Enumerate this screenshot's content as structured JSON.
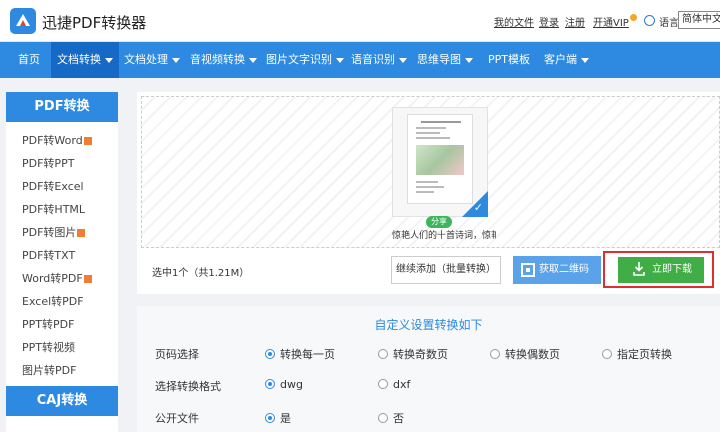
{
  "header": {
    "brand": "迅捷PDF转换器",
    "links": {
      "my_files": "我的文件",
      "login": "登录",
      "register": "注册",
      "vip": "开通VIP",
      "language": "语言",
      "language_current": "简体中文"
    }
  },
  "nav": {
    "items": [
      {
        "label": "首页"
      },
      {
        "label": "文档转换"
      },
      {
        "label": "文档处理"
      },
      {
        "label": "音视频转换"
      },
      {
        "label": "图片文字识别"
      },
      {
        "label": "语音识别"
      },
      {
        "label": "思维导图"
      },
      {
        "label": "PPT模板"
      },
      {
        "label": "客户端"
      }
    ]
  },
  "sidebar": {
    "pdf_heading": "PDF转换",
    "pdf_items": [
      {
        "label": "PDF转Word"
      },
      {
        "label": "PDF转PPT"
      },
      {
        "label": "PDF转Excel"
      },
      {
        "label": "PDF转HTML"
      },
      {
        "label": "PDF转图片"
      },
      {
        "label": "PDF转TXT"
      },
      {
        "label": "Word转PDF"
      },
      {
        "label": "Excel转PDF"
      },
      {
        "label": "PPT转PDF"
      },
      {
        "label": "PPT转视频"
      },
      {
        "label": "图片转PDF"
      }
    ],
    "caj_heading": "CAJ转换"
  },
  "upload": {
    "share_label": "分享",
    "file_caption": "惊艳人们的十首诗词，惊艳",
    "summary": "选中1个（共1.21M）",
    "add_button": "继续添加（批量转换）",
    "qr_button": "获取二维码",
    "download_button": "立即下载"
  },
  "settings": {
    "title": "自定义设置转换如下",
    "page_select_label": "页码选择",
    "page_options": [
      "转换每一页",
      "转换奇数页",
      "转换偶数页",
      "指定页转换"
    ],
    "format_label": "选择转换格式",
    "format_options": [
      "dwg",
      "dxf"
    ],
    "public_label": "公开文件",
    "public_options": [
      "是",
      "否"
    ]
  },
  "colors": {
    "brand_blue": "#2d8ae0",
    "nav_active": "#1669c4",
    "download_green": "#41ad47",
    "highlight_red": "#e02e2e"
  }
}
